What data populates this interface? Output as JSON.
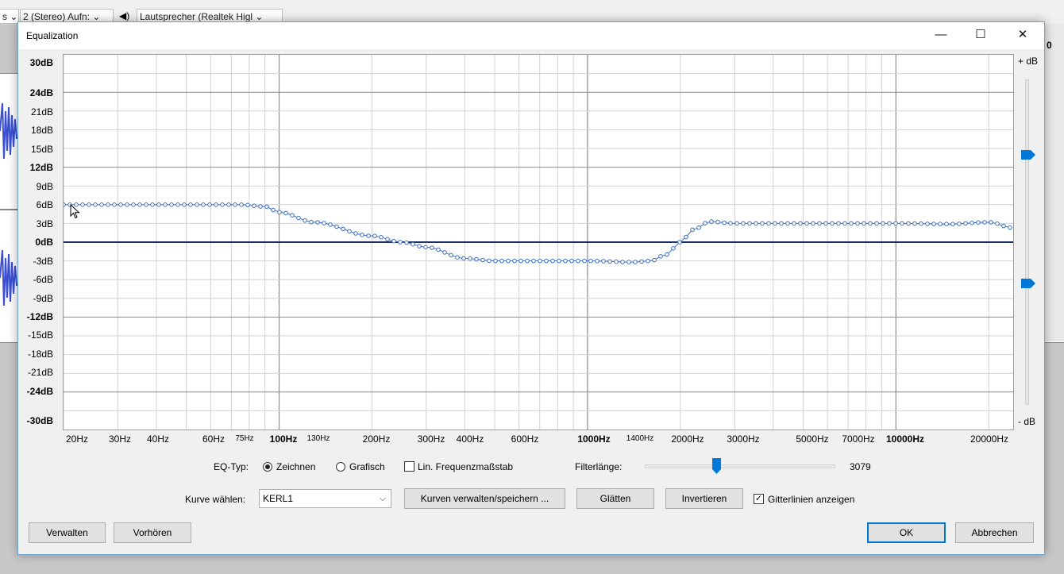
{
  "background_app": {
    "rec_channels": "2 (Stereo) Aufn:",
    "output_device": "Lautsprecher (Realtek Higl",
    "left_partial": "s",
    "right_partial": "0"
  },
  "dialog": {
    "title": "Equalization",
    "window_controls": {
      "minimize": "—",
      "maximize": "☐",
      "close": "✕"
    }
  },
  "graph": {
    "y_labels": [
      "30dB",
      "24dB",
      "21dB",
      "18dB",
      "15dB",
      "12dB",
      "9dB",
      "6dB",
      "3dB",
      "0dB",
      "-3dB",
      "-6dB",
      "-9dB",
      "-12dB",
      "-15dB",
      "-18dB",
      "-21dB",
      "-24dB",
      "-30dB"
    ],
    "x_labels": [
      "20Hz",
      "30Hz",
      "40Hz",
      "60Hz",
      "75Hz",
      "100Hz",
      "130Hz",
      "200Hz",
      "300Hz",
      "400Hz",
      "600Hz",
      "1000Hz",
      "1400Hz",
      "2000Hz",
      "3000Hz",
      "5000Hz",
      "7000Hz",
      "10000Hz",
      "20000Hz"
    ],
    "plus_db": "+ dB",
    "minus_db": "- dB",
    "curve_color": "#3d6fc0",
    "zero_line_color": "#1a2f66"
  },
  "chart_data": {
    "type": "line",
    "title": "",
    "xlabel": "",
    "ylabel": "",
    "x_scale": "log",
    "xlim": [
      20,
      24000
    ],
    "ylim": [
      -30,
      30
    ],
    "grid": true,
    "series": [
      {
        "x": [
          20,
          30,
          50,
          75,
          90,
          100,
          130,
          200,
          250,
          300,
          400,
          500,
          1000,
          1400,
          1600,
          1800,
          2000,
          2200,
          2500,
          3000,
          5000,
          10000,
          15000,
          20000,
          24000
        ],
        "y": [
          6,
          6,
          6,
          6,
          5.7,
          4.8,
          3.2,
          1.0,
          0,
          -0.8,
          -2.6,
          -3.0,
          -3.0,
          -3.2,
          -3.0,
          -2.0,
          0,
          2.0,
          3.3,
          3.0,
          3.0,
          3.0,
          2.9,
          3.2,
          2.3
        ]
      }
    ]
  },
  "controls": {
    "eq_type_label": "EQ-Typ:",
    "radio_draw": "Zeichnen",
    "radio_graphic": "Grafisch",
    "lin_freq_label": "Lin. Frequenzmaßstab",
    "filter_length_label": "Filterlänge:",
    "filter_length_value": "3079",
    "filter_length_fraction": 0.38,
    "curve_select_label": "Kurve wählen:",
    "curve_selected": "KERL1",
    "manage_curves_button": "Kurven verwalten/speichern ...",
    "smooth_button": "Glätten",
    "invert_button": "Invertieren",
    "gridlines_label": "Gitterlinien anzeigen"
  },
  "footer": {
    "manage_button": "Verwalten",
    "preview_button": "Vorhören",
    "ok_button": "OK",
    "cancel_button": "Abbrechen"
  }
}
